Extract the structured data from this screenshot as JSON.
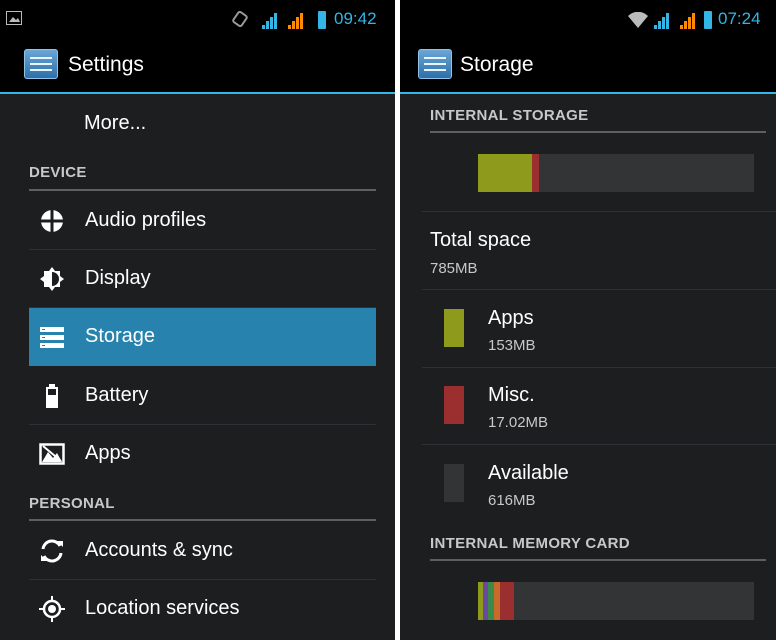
{
  "left": {
    "status_time": "09:42",
    "title": "Settings",
    "more_label": "More...",
    "sections": {
      "device": "DEVICE",
      "personal": "PERSONAL"
    },
    "items": [
      {
        "label": "Audio profiles",
        "icon": "audio-profiles-icon"
      },
      {
        "label": "Display",
        "icon": "display-icon"
      },
      {
        "label": "Storage",
        "icon": "storage-icon",
        "selected": true
      },
      {
        "label": "Battery",
        "icon": "battery-icon"
      },
      {
        "label": "Apps",
        "icon": "apps-icon"
      },
      {
        "label": "Accounts & sync",
        "icon": "sync-icon"
      },
      {
        "label": "Location services",
        "icon": "location-icon"
      }
    ]
  },
  "right": {
    "status_time": "07:24",
    "title": "Storage",
    "internal_storage_header": "INTERNAL STORAGE",
    "total": {
      "label": "Total space",
      "value": "785MB"
    },
    "categories": [
      {
        "label": "Apps",
        "value": "153MB",
        "color": "#8e9a1c"
      },
      {
        "label": "Misc.",
        "value": "17.02MB",
        "color": "#9b2f2f"
      },
      {
        "label": "Available",
        "value": "616MB",
        "color": "#333435"
      }
    ],
    "memory_card_header": "INTERNAL MEMORY CARD"
  },
  "colors": {
    "accent": "#33b5e5",
    "selected_row": "#2783ae",
    "background": "#1c1e20"
  }
}
